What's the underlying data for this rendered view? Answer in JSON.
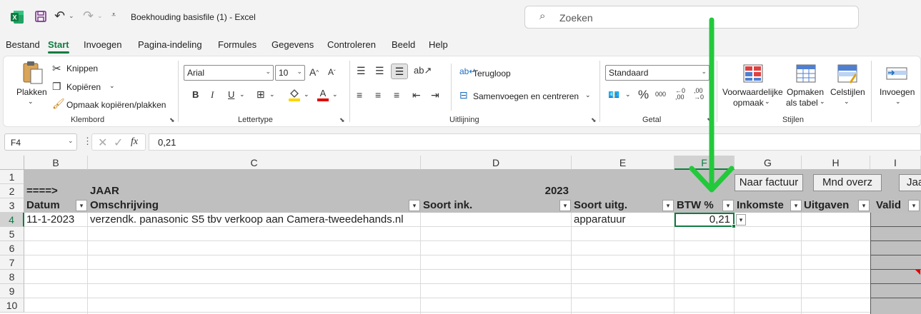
{
  "titlebar": {
    "doc_title": "Boekhouding basisfile (1)  -  Excel",
    "search_placeholder": "Zoeken"
  },
  "menu": [
    "Bestand",
    "Start",
    "Invoegen",
    "Pagina-indeling",
    "Formules",
    "Gegevens",
    "Controleren",
    "Beeld",
    "Help"
  ],
  "ribbon": {
    "clipboard": {
      "paste": "Plakken",
      "cut": "Knippen",
      "copy": "Kopiëren",
      "format_painter": "Opmaak kopiëren/plakken",
      "label": "Klembord"
    },
    "font": {
      "name": "Arial",
      "size": "10",
      "label": "Lettertype",
      "bold": "B",
      "italic": "I",
      "underline": "U"
    },
    "alignment": {
      "wrap": "Terugloop",
      "merge": "Samenvoegen en centreren",
      "label": "Uitlijning"
    },
    "number": {
      "format": "Standaard",
      "label": "Getal"
    },
    "styles": {
      "conditional1": "Voorwaardelijke",
      "conditional2": "opmaak",
      "table1": "Opmaken",
      "table2": "als tabel",
      "cell_styles": "Celstijlen",
      "label": "Stijlen"
    },
    "cells": {
      "insert": "Invoegen"
    }
  },
  "formulabar": {
    "namebox": "F4",
    "fx": "fx",
    "value": "0,21"
  },
  "grid": {
    "columns": [
      "B",
      "C",
      "D",
      "E",
      "F",
      "G",
      "H",
      "I"
    ],
    "rows": [
      "1",
      "2",
      "3",
      "4",
      "5",
      "6",
      "7",
      "8",
      "9",
      "10"
    ],
    "row2": {
      "b": "====>",
      "c": "JAAR",
      "d": "2023"
    },
    "headers": {
      "b": "Datum",
      "c": "Omschrijving",
      "d": "Soort ink.",
      "e": "Soort uitg.",
      "f": "BTW %",
      "g": "Inkomste",
      "h": "Uitgaven",
      "i": "Valid"
    },
    "row4": {
      "b": "11-1-2023",
      "c": "verzendk. panasonic S5 tbv verkoop aan Camera-tweedehands.nl",
      "e": "apparatuur",
      "f": "0,21"
    },
    "buttons": {
      "naar_factuur": "Naar factuur",
      "mnd_overz": "Mnd overz",
      "jaar": "Jaa"
    }
  },
  "colors": {
    "excel_green": "#107c41",
    "header_band": "#bfbfbf",
    "valid_col": "#c0c0c0",
    "annotation_arrow": "#22c93a"
  }
}
